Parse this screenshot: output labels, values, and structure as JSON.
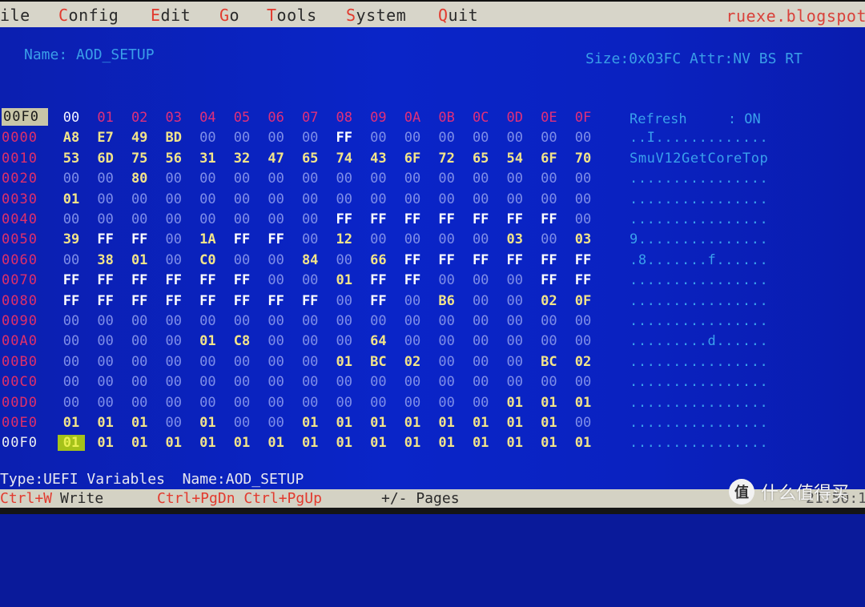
{
  "menu": {
    "items": [
      {
        "hot": "",
        "rest": "ile"
      },
      {
        "hot": "C",
        "rest": "onfig"
      },
      {
        "hot": "E",
        "rest": "dit"
      },
      {
        "hot": "G",
        "rest": "o"
      },
      {
        "hot": "T",
        "rest": "ools"
      },
      {
        "hot": "S",
        "rest": "ystem"
      },
      {
        "hot": "Q",
        "rest": "uit"
      }
    ],
    "site": "ruexe.blogspot"
  },
  "header": {
    "name": "Name: AOD_SETUP",
    "size_attr": "Size:0x03FC Attr:NV BS RT"
  },
  "grid": {
    "corner": "00F0",
    "columns": [
      "00",
      "01",
      "02",
      "03",
      "04",
      "05",
      "06",
      "07",
      "08",
      "09",
      "0A",
      "0B",
      "0C",
      "0D",
      "0E",
      "0F"
    ],
    "rows": [
      {
        "addr": "0000",
        "bytes": [
          "A8",
          "E7",
          "49",
          "BD",
          "00",
          "00",
          "00",
          "00",
          "FF",
          "00",
          "00",
          "00",
          "00",
          "00",
          "00",
          "00"
        ],
        "ascii": "..I............."
      },
      {
        "addr": "0010",
        "bytes": [
          "53",
          "6D",
          "75",
          "56",
          "31",
          "32",
          "47",
          "65",
          "74",
          "43",
          "6F",
          "72",
          "65",
          "54",
          "6F",
          "70"
        ],
        "ascii": "SmuV12GetCoreTop"
      },
      {
        "addr": "0020",
        "bytes": [
          "00",
          "00",
          "80",
          "00",
          "00",
          "00",
          "00",
          "00",
          "00",
          "00",
          "00",
          "00",
          "00",
          "00",
          "00",
          "00"
        ],
        "ascii": "................"
      },
      {
        "addr": "0030",
        "bytes": [
          "01",
          "00",
          "00",
          "00",
          "00",
          "00",
          "00",
          "00",
          "00",
          "00",
          "00",
          "00",
          "00",
          "00",
          "00",
          "00"
        ],
        "ascii": "................"
      },
      {
        "addr": "0040",
        "bytes": [
          "00",
          "00",
          "00",
          "00",
          "00",
          "00",
          "00",
          "00",
          "FF",
          "FF",
          "FF",
          "FF",
          "FF",
          "FF",
          "FF",
          "00"
        ],
        "ascii": "................"
      },
      {
        "addr": "0050",
        "bytes": [
          "39",
          "FF",
          "FF",
          "00",
          "1A",
          "FF",
          "FF",
          "00",
          "12",
          "00",
          "00",
          "00",
          "00",
          "03",
          "00",
          "03"
        ],
        "ascii": "9..............."
      },
      {
        "addr": "0060",
        "bytes": [
          "00",
          "38",
          "01",
          "00",
          "C0",
          "00",
          "00",
          "84",
          "00",
          "66",
          "FF",
          "FF",
          "FF",
          "FF",
          "FF",
          "FF"
        ],
        "ascii": ".8.......f......"
      },
      {
        "addr": "0070",
        "bytes": [
          "FF",
          "FF",
          "FF",
          "FF",
          "FF",
          "FF",
          "00",
          "00",
          "01",
          "FF",
          "FF",
          "00",
          "00",
          "00",
          "FF",
          "FF"
        ],
        "ascii": "................"
      },
      {
        "addr": "0080",
        "bytes": [
          "FF",
          "FF",
          "FF",
          "FF",
          "FF",
          "FF",
          "FF",
          "FF",
          "00",
          "FF",
          "00",
          "B6",
          "00",
          "00",
          "02",
          "0F"
        ],
        "ascii": "................"
      },
      {
        "addr": "0090",
        "bytes": [
          "00",
          "00",
          "00",
          "00",
          "00",
          "00",
          "00",
          "00",
          "00",
          "00",
          "00",
          "00",
          "00",
          "00",
          "00",
          "00"
        ],
        "ascii": "................"
      },
      {
        "addr": "00A0",
        "bytes": [
          "00",
          "00",
          "00",
          "00",
          "01",
          "C8",
          "00",
          "00",
          "00",
          "64",
          "00",
          "00",
          "00",
          "00",
          "00",
          "00"
        ],
        "ascii": ".........d......"
      },
      {
        "addr": "00B0",
        "bytes": [
          "00",
          "00",
          "00",
          "00",
          "00",
          "00",
          "00",
          "00",
          "01",
          "BC",
          "02",
          "00",
          "00",
          "00",
          "BC",
          "02"
        ],
        "ascii": "................"
      },
      {
        "addr": "00C0",
        "bytes": [
          "00",
          "00",
          "00",
          "00",
          "00",
          "00",
          "00",
          "00",
          "00",
          "00",
          "00",
          "00",
          "00",
          "00",
          "00",
          "00"
        ],
        "ascii": "................"
      },
      {
        "addr": "00D0",
        "bytes": [
          "00",
          "00",
          "00",
          "00",
          "00",
          "00",
          "00",
          "00",
          "00",
          "00",
          "00",
          "00",
          "00",
          "01",
          "01",
          "01"
        ],
        "ascii": "................"
      },
      {
        "addr": "00E0",
        "bytes": [
          "01",
          "01",
          "01",
          "00",
          "01",
          "00",
          "00",
          "01",
          "01",
          "01",
          "01",
          "01",
          "01",
          "01",
          "01",
          "00"
        ],
        "ascii": "................"
      },
      {
        "addr": "00F0",
        "bytes": [
          "01",
          "01",
          "01",
          "01",
          "01",
          "01",
          "01",
          "01",
          "01",
          "01",
          "01",
          "01",
          "01",
          "01",
          "01",
          "01"
        ],
        "ascii": "................"
      }
    ],
    "selected": {
      "row": 15,
      "col": 0
    }
  },
  "side": {
    "refresh": "Refresh     : ON"
  },
  "status": {
    "text": "Type:UEFI Variables  Name:AOD_SETUP"
  },
  "bottom": {
    "write_key": "Ctrl+W",
    "write_label": "Write",
    "page_keys": "Ctrl+PgDn Ctrl+PgUp",
    "pages_label": "+/- Pages",
    "clock": "21:50:1"
  },
  "watermark": {
    "logo": "值",
    "text": "什么值得买"
  },
  "colors": {
    "background": "#0a22c0",
    "menubar": "#d7d5c9",
    "hotkey": "#e23a2e",
    "address": "#e0306a",
    "zero_byte": "#7f8ee8",
    "nonzero_byte": "#f2e48a",
    "ff_byte": "#ffffff",
    "ascii": "#3aa0ec",
    "selection": "#a5c21a"
  }
}
